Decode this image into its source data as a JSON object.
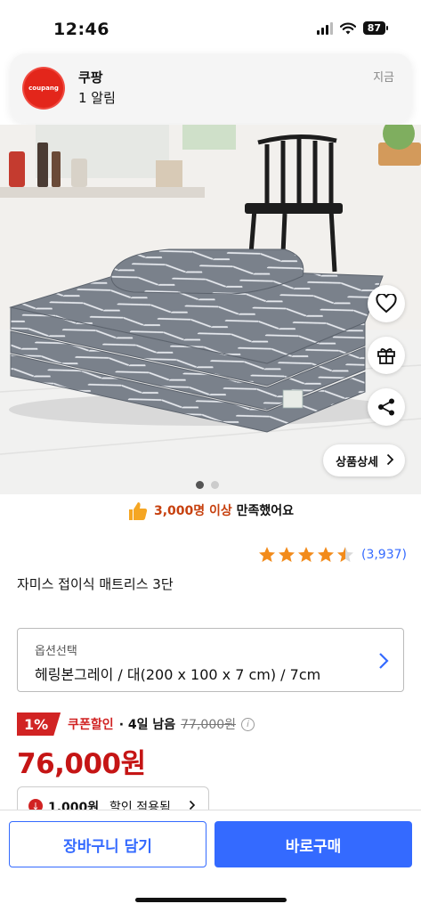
{
  "status_bar": {
    "time": "12:46",
    "battery": "87"
  },
  "notification": {
    "app_logo_text": "coupang",
    "title": "쿠팡",
    "body": "1 알림",
    "time": "지금"
  },
  "product_image": {
    "detail_button": "상품상세",
    "icons": [
      "heart-icon",
      "gift-icon",
      "share-icon"
    ],
    "pager": {
      "total": 2,
      "current": 1
    }
  },
  "satisfaction": {
    "highlight": "3,000명 이상",
    "text": " 만족했어요"
  },
  "rating": {
    "stars": 4.5,
    "count": "(3,937)"
  },
  "product": {
    "title": "자미스 접이식 매트리스 3단"
  },
  "option": {
    "label": "옵션선택",
    "value": "헤링본그레이 / 대(200 x 100 x 7 cm) / 7cm"
  },
  "pricing": {
    "discount_percent": "1%",
    "coupon_label": "쿠폰할인",
    "deadline": "· 4일 남음",
    "original_price": "77,000원",
    "sale_price": "76,000원"
  },
  "coupon_chip": {
    "amount": "1,000원",
    "label": "할인 적용됨"
  },
  "actions": {
    "cart": "장바구니 담기",
    "buy": "바로구매"
  },
  "colors": {
    "brand_blue": "#346aff",
    "sale_red": "#c51515",
    "star": "#f28b1b"
  }
}
